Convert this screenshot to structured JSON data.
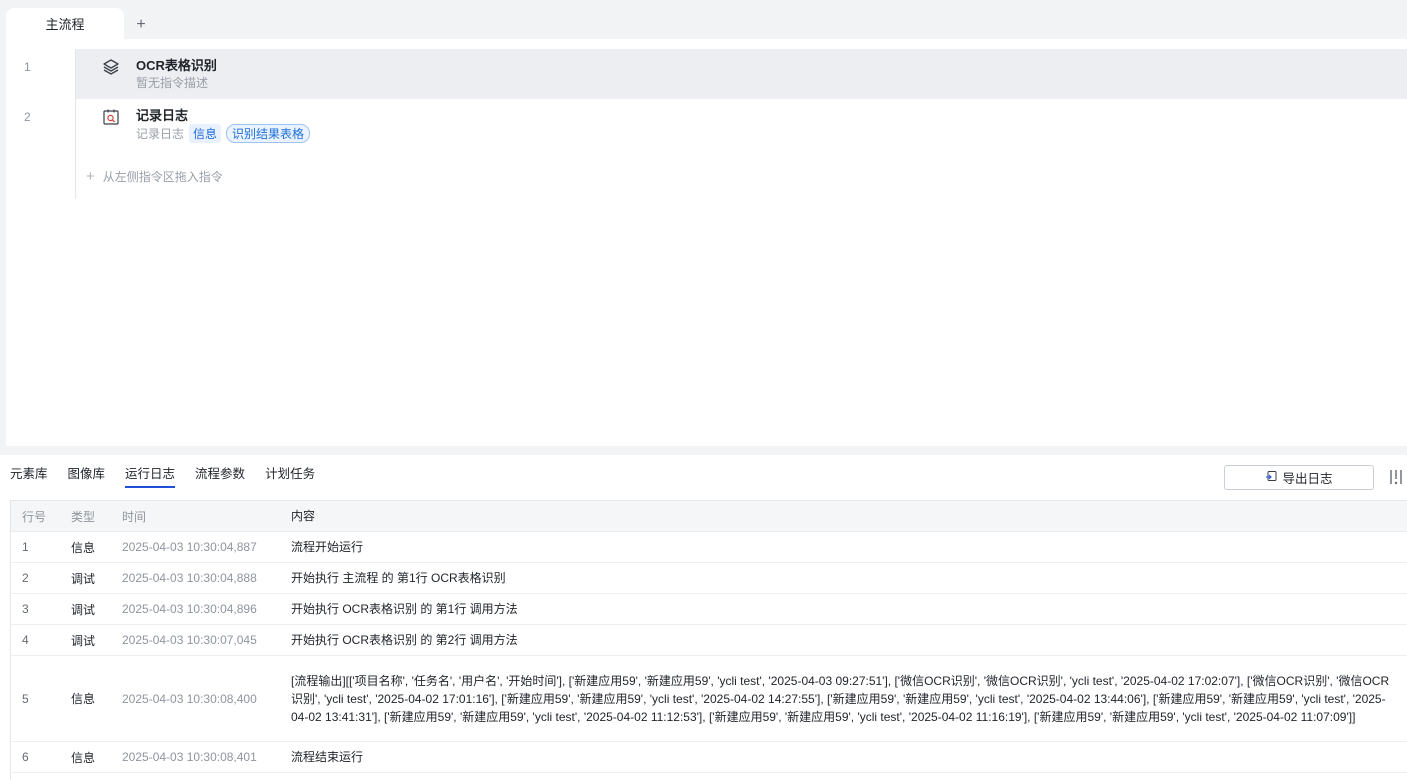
{
  "tabs": {
    "main_label": "主流程",
    "add_label": "+"
  },
  "steps": [
    {
      "num": "1",
      "title": "OCR表格识别",
      "desc": "暂无指令描述",
      "icon": "layers-icon"
    },
    {
      "num": "2",
      "title": "记录日志",
      "desc_prefix": "记录日志",
      "level_tag": "信息",
      "var_tag": "识别结果表格",
      "icon": "log-search-icon"
    }
  ],
  "drop_hint": "从左侧指令区拖入指令",
  "panel": {
    "tabs": [
      "元素库",
      "图像库",
      "运行日志",
      "流程参数",
      "计划任务"
    ],
    "active_tab": "运行日志",
    "export_label": "导出日志"
  },
  "log_table": {
    "headers": {
      "idx": "行号",
      "type": "类型",
      "time": "时间",
      "content": "内容"
    },
    "rows": [
      {
        "idx": "1",
        "type": "信息",
        "time": "2025-04-03 10:30:04,887",
        "content": "流程开始运行"
      },
      {
        "idx": "2",
        "type": "调试",
        "time": "2025-04-03 10:30:04,888",
        "content": "开始执行 主流程 的 第1行 OCR表格识别"
      },
      {
        "idx": "3",
        "type": "调试",
        "time": "2025-04-03 10:30:04,896",
        "content": "开始执行 OCR表格识别 的 第1行 调用方法"
      },
      {
        "idx": "4",
        "type": "调试",
        "time": "2025-04-03 10:30:07,045",
        "content": "开始执行 OCR表格识别 的 第2行 调用方法"
      },
      {
        "idx": "5",
        "type": "信息",
        "time": "2025-04-03 10:30:08,400",
        "content": "[流程输出][['项目名称', '任务名', '用户名', '开始时间'], ['新建应用59', '新建应用59', 'ycli test', '2025-04-03 09:27:51'], ['微信OCR识别', '微信OCR识别', 'ycli test', '2025-04-02 17:02:07'], ['微信OCR识别', '微信OCR识别', 'ycli test', '2025-04-02 17:01:16'], ['新建应用59', '新建应用59', 'ycli test', '2025-04-02 14:27:55'], ['新建应用59', '新建应用59', 'ycli test', '2025-04-02 13:44:06'], ['新建应用59', '新建应用59', 'ycli test', '2025-04-02 13:41:31'], ['新建应用59', '新建应用59', 'ycli test', '2025-04-02 11:12:53'], ['新建应用59', '新建应用59', 'ycli test', '2025-04-02 11:16:19'], ['新建应用59', '新建应用59', 'ycli test', '2025-04-02 11:07:09']]"
      },
      {
        "idx": "6",
        "type": "信息",
        "time": "2025-04-03 10:30:08,401",
        "content": "流程结束运行"
      }
    ]
  },
  "colors": {
    "accent": "#1f4fd8",
    "tag_blue": "#1e6fd9",
    "selected_row": "#eceef2"
  }
}
